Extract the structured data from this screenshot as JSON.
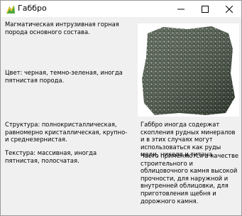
{
  "window": {
    "title": "Габбро",
    "icon": "gabbro-app-icon",
    "controls": [
      "minimize-icon",
      "maximize-icon",
      "close-icon"
    ]
  },
  "content": {
    "p1": "Магматическая интрузивная горная порода основного состава.",
    "p2": "Цвет: черная, темно-зеленая, иногда пятнистая порода.",
    "p3": "Структура: полнокристаллическая, равномерно кристаллическая, крупно- и среднезернистая.",
    "p4": "Текстура: массивная, иногда пятнистая, полосчатая.",
    "p5": "Габбро иногда содержат скопления рудных минералов и в этих случаях могут использоваться как руды меди, никеля и титана.",
    "p6": "Часто применяются в качестве строительного и облицовочного камня высокой прочности, для наружной и внутренней облицовки, для приготовления щебня и дорожного камня."
  },
  "image": {
    "subject": "gabbro-rock-photo"
  }
}
